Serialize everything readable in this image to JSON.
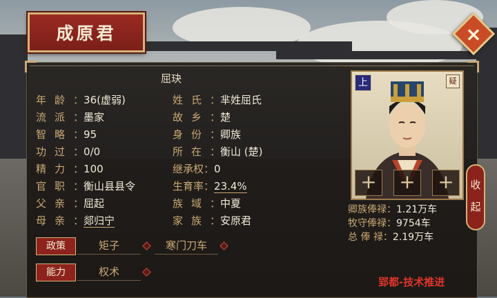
{
  "title": "成原君",
  "close_label": "×",
  "character": {
    "name": "屈玦",
    "rank_badge": "上",
    "trait_badge": "疑",
    "slots": [
      "+",
      "+",
      "+"
    ]
  },
  "attributes_left": [
    {
      "label": "年龄",
      "value": "36(虚弱)"
    },
    {
      "label": "流派",
      "value": "墨家"
    },
    {
      "label": "智略",
      "value": "95"
    },
    {
      "label": "功过",
      "value": "0/0"
    },
    {
      "label": "精力",
      "value": "100"
    },
    {
      "label": "官职",
      "value": "衡山县县令"
    },
    {
      "label": "父亲",
      "value": "屈起"
    },
    {
      "label": "母亲",
      "value": "郯归宁"
    }
  ],
  "attributes_right": [
    {
      "label": "姓氏",
      "value": "芈姓屈氏"
    },
    {
      "label": "故乡",
      "value": "楚"
    },
    {
      "label": "身份",
      "value": "卿族"
    },
    {
      "label": "所在",
      "value": "衡山 (楚)"
    },
    {
      "label": "继承权",
      "value": "0"
    },
    {
      "label": "生育率",
      "value": "23.4%"
    },
    {
      "label": "族域",
      "value": "中夏"
    },
    {
      "label": "家族",
      "value": "安原君"
    }
  ],
  "salaries": [
    {
      "label": "卿族俸禄：",
      "value": "1.21万车"
    },
    {
      "label": "牧守俸禄：",
      "value": "9754车"
    },
    {
      "label": "总 俸 禄：",
      "value": "2.19万车"
    }
  ],
  "tags": {
    "policy_label": "政策",
    "policy_items": [
      "矩子",
      "寒门刀车"
    ],
    "ability_label": "能力",
    "ability_items": [
      "权术"
    ]
  },
  "collapse_label": "收起",
  "status_text": "郢都-技术推进"
}
